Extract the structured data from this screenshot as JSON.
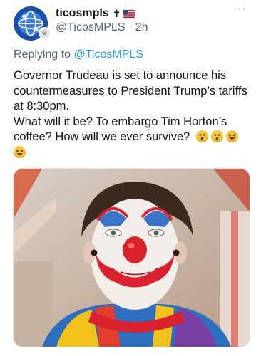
{
  "author": {
    "display_name": "ticosmpls",
    "name_suffix": "✝",
    "handle": "@TicosMPLS",
    "separator": "·",
    "time": "2h"
  },
  "icons": {
    "avatar": "globe-icon",
    "more": "more-icon",
    "flag": "us-flag-icon"
  },
  "reply": {
    "prefix": "Replying to ",
    "mention": "@TicosMPLS"
  },
  "tweet": {
    "paragraph1": "Governor Trudeau is set to announce his countermeasures to President Trump’s tariffs at 8:30pm.",
    "paragraph2": "What will it be? To embargo Tim Horton’s coffee? How will we ever survive?",
    "emojis": [
      "astonished-face-emoji",
      "astonished-face-emoji",
      "laughing-face-emoji",
      "laughing-face-emoji"
    ]
  },
  "colors": {
    "link": "#1d9bf0",
    "secondary": "#536471",
    "text": "#0f1419"
  },
  "media": {
    "subject": "clown-makeup-photo"
  }
}
